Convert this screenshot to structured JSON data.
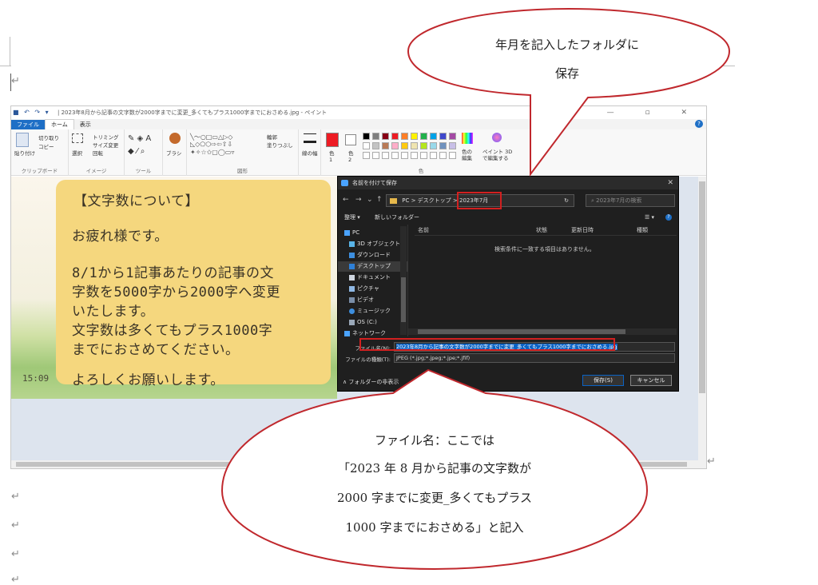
{
  "paint": {
    "title": "| 2023年8月から記事の文字数が2000字までに変更_多くてもプラス1000字までにおさめる.jpg - ペイント",
    "tabs": [
      "ファイル",
      "ホーム",
      "表示"
    ],
    "ribbon": {
      "clipboard": {
        "paste": "貼り付け",
        "cut": "切り取り",
        "copy": "コピー",
        "group": "クリップボード"
      },
      "image": {
        "select": "選択",
        "crop": "トリミング",
        "resize": "サイズ変更",
        "rotate": "回転",
        "group": "イメージ"
      },
      "tools": {
        "group": "ツール"
      },
      "brushes": "ブラシ",
      "shapes": {
        "outline": "輪郭",
        "fill": "塗りつぶし",
        "group": "図形"
      },
      "size": "線の幅",
      "color1": "色\n1",
      "color2": "色\n2",
      "edit_colors": "色の\n編集",
      "paint3d": "ペイント 3D\nで編集する",
      "colors_group": "色"
    },
    "palette": [
      "#000000",
      "#7f7f7f",
      "#880015",
      "#ed1c24",
      "#ff7f27",
      "#fff200",
      "#22b14c",
      "#00a2e8",
      "#3f48cc",
      "#a349a4",
      "#ffffff",
      "#c3c3c3",
      "#b97a57",
      "#ffaec9",
      "#ffc90e",
      "#efe4b0",
      "#b5e61d",
      "#99d9ea",
      "#7092be",
      "#c8bfe7"
    ]
  },
  "note": {
    "lines": [
      "【文字数について】",
      "お疲れ様です。",
      "8/1から1記事あたりの記事の文",
      "字数を5000字から2000字へ変更",
      "いたします。",
      "文字数は多くてもプラス1000字",
      "までにおさめてください。",
      "よろしくお願いします。"
    ],
    "clock": "15:09"
  },
  "dialog": {
    "title": "名前を付けて保存",
    "path": [
      "PC",
      "デスクトップ",
      "2023年7月"
    ],
    "search_placeholder": "2023年7月の検索",
    "organize": "整理 ▾",
    "new_folder": "新しいフォルダー",
    "nav": [
      "PC",
      "3D オブジェクト",
      "ダウンロード",
      "デスクトップ",
      "ドキュメント",
      "ピクチャ",
      "ビデオ",
      "ミュージック",
      "OS (C:)",
      "ネットワーク"
    ],
    "columns": [
      "名前",
      "状態",
      "更新日時",
      "種類"
    ],
    "empty_message": "検索条件に一致する項目はありません。",
    "filename_label": "ファイル名(N):",
    "filename_value": "2023年8月から記事の文字数が2000字までに変更_多くてもプラス1000字までにおさめる.jpg",
    "filetype_label": "ファイルの種類(T):",
    "filetype_value": "JPEG (*.jpg;*.jpeg;*.jpe;*.jfif)",
    "hide_folders": "フォルダーの非表示",
    "save": "保存(S)",
    "cancel": "キャンセル"
  },
  "callouts": {
    "top": [
      "年月を記入したフォルダに",
      "保存"
    ],
    "bottom": [
      "ファイル名：ここでは",
      "「2023 年 8 月から記事の文字数が",
      "2000 字までに変更_多くてもプラス",
      "1000 字までにおさめる」と記入"
    ]
  },
  "colors": {
    "callout_border": "#c0282d",
    "highlight": "#d12020"
  },
  "para_mark": "↵"
}
